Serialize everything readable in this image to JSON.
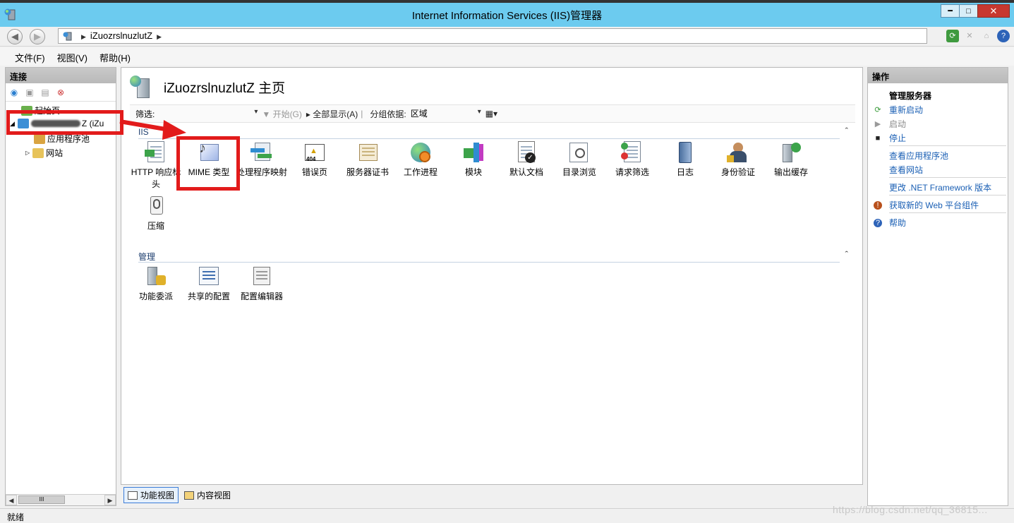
{
  "window": {
    "title": "Internet Information Services (IIS)管理器",
    "minimize": "━",
    "maximize": "□",
    "close": "✕"
  },
  "address": {
    "back": "◀",
    "forward": "▶",
    "path": "iZuozrslnuzlutZ",
    "separator": "▶"
  },
  "menu": [
    "文件(F)",
    "视图(V)",
    "帮助(H)"
  ],
  "connections": {
    "header": "连接",
    "tree": {
      "start_page": "起始页",
      "server_suffix": "Z (iZu",
      "app_pools": "应用程序池",
      "sites": "网站"
    },
    "scroll_thumb": "III"
  },
  "center": {
    "title": "iZuozrslnuzlutZ 主页",
    "filter_label": "筛选:",
    "start_button": "开始(G)",
    "show_all": "全部显示(A)",
    "group_by_label": "分组依据:",
    "group_by_value": "区域",
    "groups": [
      {
        "name": "IIS",
        "items": [
          {
            "label": "HTTP 响应标头",
            "icon": "http-headers-icon"
          },
          {
            "label": "MIME 类型",
            "icon": "mime-types-icon"
          },
          {
            "label": "处理程序映射",
            "icon": "handler-mappings-icon"
          },
          {
            "label": "错误页",
            "icon": "error-pages-icon"
          },
          {
            "label": "服务器证书",
            "icon": "server-certificates-icon"
          },
          {
            "label": "工作进程",
            "icon": "worker-processes-icon"
          },
          {
            "label": "模块",
            "icon": "modules-icon"
          },
          {
            "label": "默认文档",
            "icon": "default-document-icon"
          },
          {
            "label": "目录浏览",
            "icon": "directory-browsing-icon"
          },
          {
            "label": "请求筛选",
            "icon": "request-filtering-icon"
          },
          {
            "label": "日志",
            "icon": "logging-icon"
          },
          {
            "label": "身份验证",
            "icon": "authentication-icon"
          },
          {
            "label": "输出缓存",
            "icon": "output-caching-icon"
          },
          {
            "label": "压缩",
            "icon": "compression-icon"
          }
        ]
      },
      {
        "name": "管理",
        "items": [
          {
            "label": "功能委派",
            "icon": "feature-delegation-icon"
          },
          {
            "label": "共享的配置",
            "icon": "shared-configuration-icon"
          },
          {
            "label": "配置编辑器",
            "icon": "configuration-editor-icon"
          }
        ]
      }
    ],
    "error_page_badge": "404",
    "collapse_glyph": "ˆ",
    "view_tabs": [
      "功能视图",
      "内容视图"
    ]
  },
  "actions": {
    "header": "操作",
    "manage_server": "管理服务器",
    "restart": "重新启动",
    "start": "启动",
    "stop": "停止",
    "view_app_pools": "查看应用程序池",
    "view_sites": "查看网站",
    "change_framework": "更改 .NET Framework 版本",
    "get_web_platform": "获取新的 Web 平台组件",
    "help": "帮助"
  },
  "status": {
    "text": "就绪"
  },
  "watermark": "https://blog.csdn.net/qq_36815..."
}
